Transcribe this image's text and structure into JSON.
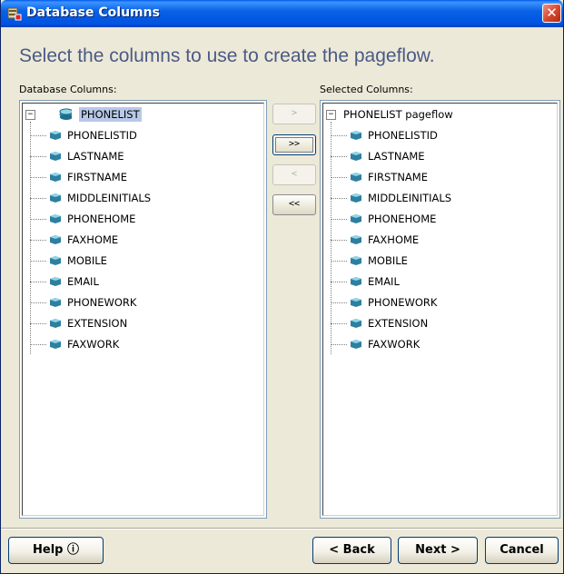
{
  "window": {
    "title": "Database Columns",
    "close_label": "✕"
  },
  "heading": "Select the columns to use to create the pageflow.",
  "left_panel": {
    "label": "Database Columns:",
    "root_label": "PHONELIST",
    "expander": "−",
    "columns": [
      "PHONELISTID",
      "LASTNAME",
      "FIRSTNAME",
      "MIDDLEINITIALS",
      "PHONEHOME",
      "FAXHOME",
      "MOBILE",
      "EMAIL",
      "PHONEWORK",
      "EXTENSION",
      "FAXWORK"
    ]
  },
  "right_panel": {
    "label": "Selected Columns:",
    "root_label": "PHONELIST pageflow",
    "expander": "−",
    "columns": [
      "PHONELISTID",
      "LASTNAME",
      "FIRSTNAME",
      "MIDDLEINITIALS",
      "PHONEHOME",
      "FAXHOME",
      "MOBILE",
      "EMAIL",
      "PHONEWORK",
      "EXTENSION",
      "FAXWORK"
    ]
  },
  "transfer_buttons": {
    "add_one": ">",
    "add_all": ">>",
    "remove_one": "<",
    "remove_all": "<<"
  },
  "footer": {
    "help": "Help ⓘ",
    "back": "< Back",
    "next": "Next >",
    "cancel": "Cancel"
  },
  "colors": {
    "titlebar": "#0a62e6",
    "heading": "#4a5a84",
    "column_icon": "#2e7fa0",
    "selection": "#b8c8e8"
  },
  "icons": {
    "title": "database-columns-icon",
    "root": "database-table-icon",
    "column": "column-icon"
  }
}
